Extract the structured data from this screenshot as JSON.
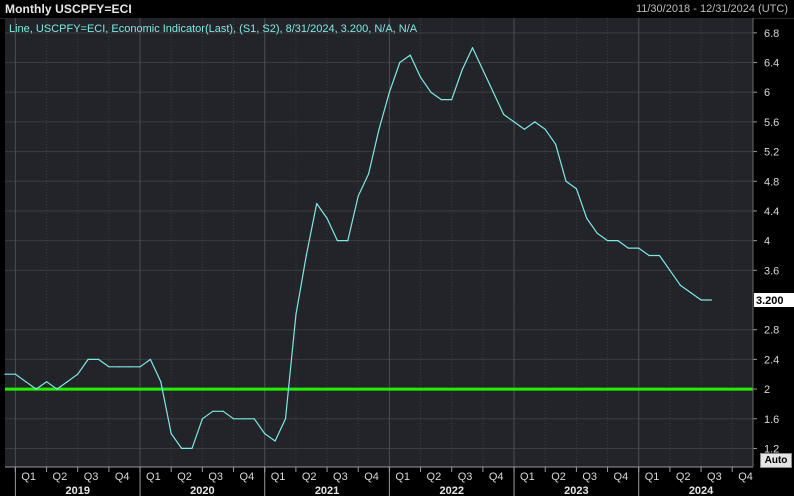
{
  "header": {
    "title": "Monthly USCPFY=ECI",
    "date_range": "11/30/2018 - 12/31/2024 (UTC)"
  },
  "controls": {
    "auto_label": "Auto"
  },
  "colors": {
    "background": "#000000",
    "plot_background": "#222429",
    "line": "#7fe8e2",
    "reference_line": "#22ee00",
    "grid": "#3a3d42",
    "last_value_label_bg": "#ffffff"
  },
  "chart_data": {
    "type": "line",
    "legend_text": "Line, USCPFY=ECI, Economic Indicator(Last), (S1, S2), 8/31/2024, 3.200, N/A, N/A",
    "last_value_label": "3.200",
    "x_range": [
      "2018-12",
      "2024-12"
    ],
    "ylim": [
      0.95,
      7.0
    ],
    "y_ticks": [
      {
        "value": 1.2,
        "label": "1.2"
      },
      {
        "value": 1.6,
        "label": "1.6"
      },
      {
        "value": 2.0,
        "label": "2"
      },
      {
        "value": 2.4,
        "label": "2.4"
      },
      {
        "value": 2.8,
        "label": "2.8"
      },
      {
        "value": 3.6,
        "label": "3.6"
      },
      {
        "value": 4.0,
        "label": "4"
      },
      {
        "value": 4.4,
        "label": "4.4"
      },
      {
        "value": 4.8,
        "label": "4.8"
      },
      {
        "value": 5.2,
        "label": "5.2"
      },
      {
        "value": 5.6,
        "label": "5.6"
      },
      {
        "value": 6.0,
        "label": "6"
      },
      {
        "value": 6.4,
        "label": "6.4"
      },
      {
        "value": 6.8,
        "label": "6.8"
      }
    ],
    "reference_line_value": 2.0,
    "quarter_ticks": [
      {
        "date": "2019-01",
        "label": "Q1"
      },
      {
        "date": "2019-04",
        "label": "Q2"
      },
      {
        "date": "2019-07",
        "label": "Q3"
      },
      {
        "date": "2019-10",
        "label": "Q4"
      },
      {
        "date": "2020-01",
        "label": "Q1"
      },
      {
        "date": "2020-04",
        "label": "Q2"
      },
      {
        "date": "2020-07",
        "label": "Q3"
      },
      {
        "date": "2020-10",
        "label": "Q4"
      },
      {
        "date": "2021-01",
        "label": "Q1"
      },
      {
        "date": "2021-04",
        "label": "Q2"
      },
      {
        "date": "2021-07",
        "label": "Q3"
      },
      {
        "date": "2021-10",
        "label": "Q4"
      },
      {
        "date": "2022-01",
        "label": "Q1"
      },
      {
        "date": "2022-04",
        "label": "Q2"
      },
      {
        "date": "2022-07",
        "label": "Q3"
      },
      {
        "date": "2022-10",
        "label": "Q4"
      },
      {
        "date": "2023-01",
        "label": "Q1"
      },
      {
        "date": "2023-04",
        "label": "Q2"
      },
      {
        "date": "2023-07",
        "label": "Q3"
      },
      {
        "date": "2023-10",
        "label": "Q4"
      },
      {
        "date": "2024-01",
        "label": "Q1"
      },
      {
        "date": "2024-04",
        "label": "Q2"
      },
      {
        "date": "2024-07",
        "label": "Q3"
      },
      {
        "date": "2024-10",
        "label": "Q4"
      }
    ],
    "year_labels": [
      {
        "date": "2019-07",
        "label": "2019"
      },
      {
        "date": "2020-07",
        "label": "2020"
      },
      {
        "date": "2021-07",
        "label": "2021"
      },
      {
        "date": "2022-07",
        "label": "2022"
      },
      {
        "date": "2023-07",
        "label": "2023"
      },
      {
        "date": "2024-07",
        "label": "2024"
      }
    ],
    "year_separators": [
      "2019-01",
      "2020-01",
      "2021-01",
      "2022-01",
      "2023-01",
      "2024-01"
    ],
    "series": [
      {
        "x": [
          "2018-12",
          "2019-01",
          "2019-02",
          "2019-03",
          "2019-04",
          "2019-05",
          "2019-06",
          "2019-07",
          "2019-08",
          "2019-09",
          "2019-10",
          "2019-11",
          "2019-12",
          "2020-01",
          "2020-02",
          "2020-03",
          "2020-04",
          "2020-05",
          "2020-06",
          "2020-07",
          "2020-08",
          "2020-09",
          "2020-10",
          "2020-11",
          "2020-12",
          "2021-01",
          "2021-02",
          "2021-03",
          "2021-04",
          "2021-05",
          "2021-06",
          "2021-07",
          "2021-08",
          "2021-09",
          "2021-10",
          "2021-11",
          "2021-12",
          "2022-01",
          "2022-02",
          "2022-03",
          "2022-04",
          "2022-05",
          "2022-06",
          "2022-07",
          "2022-08",
          "2022-09",
          "2022-10",
          "2022-11",
          "2022-12",
          "2023-01",
          "2023-02",
          "2023-03",
          "2023-04",
          "2023-05",
          "2023-06",
          "2023-07",
          "2023-08",
          "2023-09",
          "2023-10",
          "2023-11",
          "2023-12",
          "2024-01",
          "2024-02",
          "2024-03",
          "2024-04",
          "2024-05",
          "2024-06",
          "2024-07",
          "2024-08"
        ],
        "values": [
          2.2,
          2.2,
          2.1,
          2.0,
          2.1,
          2.0,
          2.1,
          2.2,
          2.4,
          2.4,
          2.3,
          2.3,
          2.3,
          2.3,
          2.4,
          2.1,
          1.4,
          1.2,
          1.2,
          1.6,
          1.7,
          1.7,
          1.6,
          1.6,
          1.6,
          1.4,
          1.3,
          1.6,
          3.0,
          3.8,
          4.5,
          4.3,
          4.0,
          4.0,
          4.6,
          4.9,
          5.5,
          6.0,
          6.4,
          6.5,
          6.2,
          6.0,
          5.9,
          5.9,
          6.3,
          6.6,
          6.3,
          6.0,
          5.7,
          5.6,
          5.5,
          5.6,
          5.5,
          5.3,
          4.8,
          4.7,
          4.3,
          4.1,
          4.0,
          4.0,
          3.9,
          3.9,
          3.8,
          3.8,
          3.6,
          3.4,
          3.3,
          3.2,
          3.2
        ]
      }
    ]
  }
}
